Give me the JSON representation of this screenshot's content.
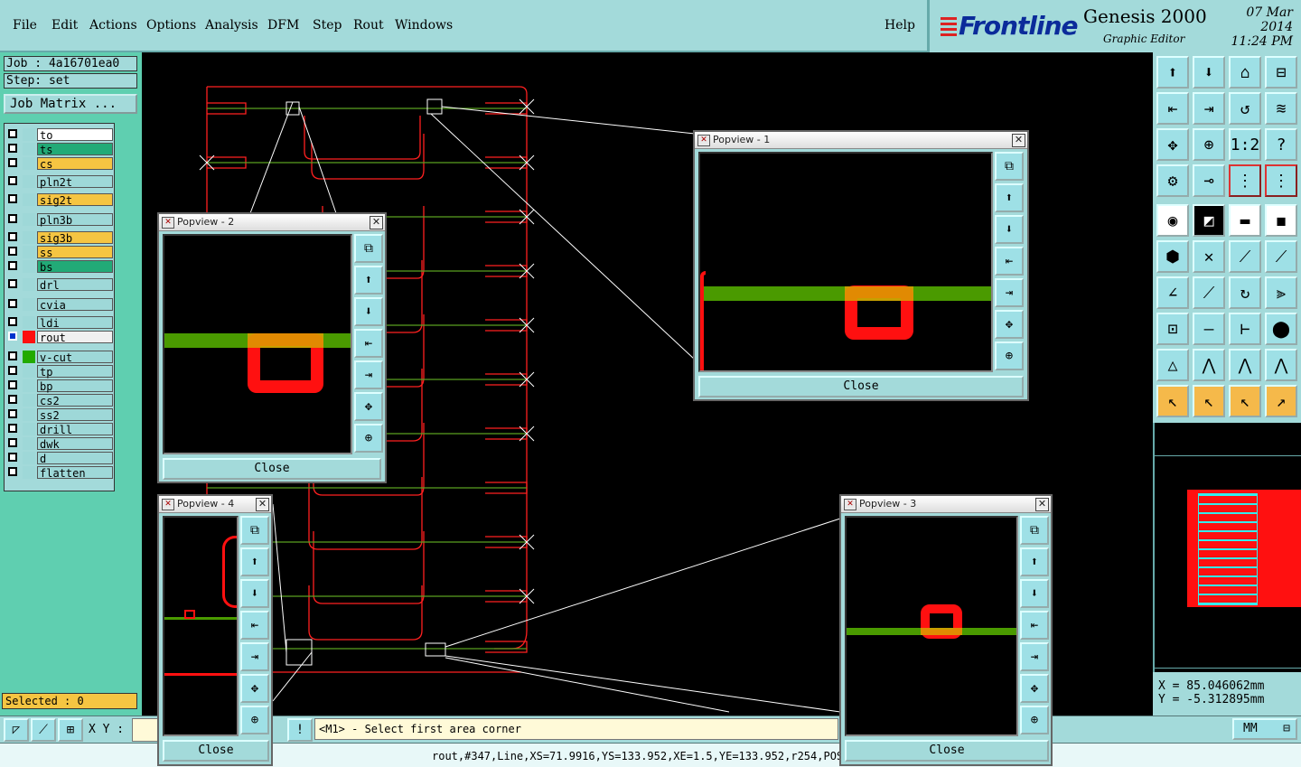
{
  "menu": {
    "items": [
      "File",
      "Edit",
      "Actions",
      "Options",
      "Analysis",
      "DFM",
      "Step",
      "Rout",
      "Windows"
    ],
    "help": "Help"
  },
  "brand": {
    "logo": "Frontline",
    "title": "Genesis 2000",
    "subtitle": "Graphic Editor",
    "date": "07 Mar 2014",
    "time": "11:24 PM"
  },
  "job": {
    "job_label": "Job : 4a16701ea0",
    "step_label": "Step: set",
    "matrix_button": "Job Matrix ..."
  },
  "layers": [
    {
      "name": "to",
      "color": "#ffffff",
      "swatch": "#9ed8d8"
    },
    {
      "name": "ts",
      "color": "#22aa77",
      "swatch": "#9ed8d8"
    },
    {
      "name": "cs",
      "color": "#f5c542",
      "swatch": "#9ed8d8"
    },
    {
      "name": "pln2t",
      "color": "#9ed8d8",
      "swatch": "#9ed8d8"
    },
    {
      "name": "sig2t",
      "color": "#f5c542",
      "swatch": "#9ed8d8"
    },
    {
      "name": "pln3b",
      "color": "#9ed8d8",
      "swatch": "#9ed8d8"
    },
    {
      "name": "sig3b",
      "color": "#f5c542",
      "swatch": "#9ed8d8"
    },
    {
      "name": "ss",
      "color": "#f5c542",
      "swatch": "#9ed8d8"
    },
    {
      "name": "bs",
      "color": "#22aa77",
      "swatch": "#9ed8d8"
    },
    {
      "name": "drl",
      "color": "#9ed8d8",
      "swatch": "#9ed8d8"
    },
    {
      "name": "cvia",
      "color": "#9ed8d8",
      "swatch": "#9ed8d8"
    },
    {
      "name": "ldi",
      "color": "#9ed8d8",
      "swatch": "#9ed8d8"
    },
    {
      "name": "rout",
      "color": "#f0f0f0",
      "swatch": "#ff1010"
    },
    {
      "name": "v-cut",
      "color": "#9ed8d8",
      "swatch": "#22aa00"
    },
    {
      "name": "tp",
      "color": "#9ed8d8",
      "swatch": "#9ed8d8"
    },
    {
      "name": "bp",
      "color": "#9ed8d8",
      "swatch": "#9ed8d8"
    },
    {
      "name": "cs2",
      "color": "#9ed8d8",
      "swatch": "#9ed8d8"
    },
    {
      "name": "ss2",
      "color": "#9ed8d8",
      "swatch": "#9ed8d8"
    },
    {
      "name": "drill",
      "color": "#9ed8d8",
      "swatch": "#9ed8d8"
    },
    {
      "name": "dwk",
      "color": "#9ed8d8",
      "swatch": "#9ed8d8"
    },
    {
      "name": "d",
      "color": "#9ed8d8",
      "swatch": "#9ed8d8"
    },
    {
      "name": "flatten",
      "color": "#9ed8d8",
      "swatch": "#9ed8d8"
    }
  ],
  "selected": "Selected : 0",
  "popviews": [
    {
      "title": "Popview - 1",
      "close": "Close"
    },
    {
      "title": "Popview - 2",
      "close": "Close"
    },
    {
      "title": "Popview - 3",
      "close": "Close"
    },
    {
      "title": "Popview - 4",
      "close": "Close"
    }
  ],
  "coords": {
    "x": "X  = 85.046062mm",
    "y": "Y  = -5.312895mm"
  },
  "bottom": {
    "xy_label": "X Y :",
    "message": "<M1> - Select first area corner",
    "unit": "MM"
  },
  "status": "rout,#347,Line,XS=71.9916,YS=133.952,XE=1.5,YE=133.952,r254,POS,"
}
